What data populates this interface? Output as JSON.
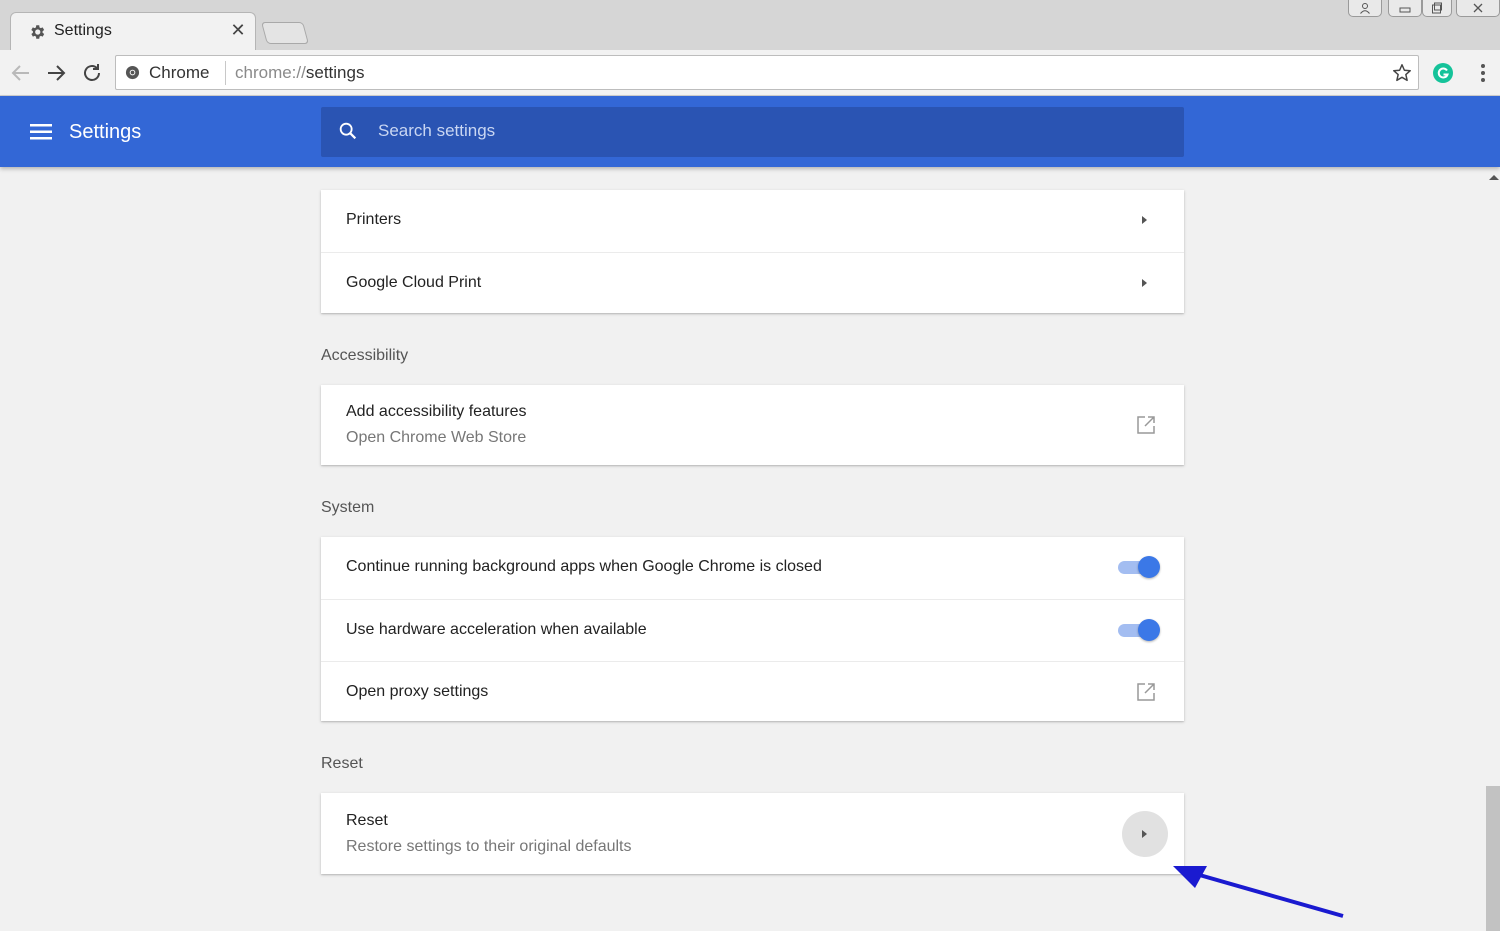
{
  "window": {
    "tab_title": "Settings"
  },
  "toolbar": {
    "chip_label": "Chrome",
    "url_scheme": "chrome://",
    "url_path": "settings",
    "icons": [
      "back-icon",
      "forward-icon",
      "reload-icon",
      "secure-icon",
      "star-icon",
      "grammarly-extension-icon",
      "more-menu-icon"
    ]
  },
  "header": {
    "title": "Settings",
    "search_placeholder": "Search settings"
  },
  "sections": {
    "printing": {
      "rows": [
        {
          "label": "Printers"
        },
        {
          "label": "Google Cloud Print"
        }
      ]
    },
    "accessibility": {
      "heading": "Accessibility",
      "rows": [
        {
          "label": "Add accessibility features",
          "sublabel": "Open Chrome Web Store"
        }
      ]
    },
    "system": {
      "heading": "System",
      "rows": [
        {
          "label": "Continue running background apps when Google Chrome is closed",
          "enabled": true
        },
        {
          "label": "Use hardware acceleration when available",
          "enabled": true
        },
        {
          "label": "Open proxy settings"
        }
      ]
    },
    "reset": {
      "heading": "Reset",
      "rows": [
        {
          "label": "Reset",
          "sublabel": "Restore settings to their original defaults"
        }
      ]
    }
  },
  "colors": {
    "header_blue": "#3367d6",
    "search_box": "#2a54b3",
    "toggle_on": "#3b78e7",
    "annotation_arrow": "#1a1ad0"
  }
}
